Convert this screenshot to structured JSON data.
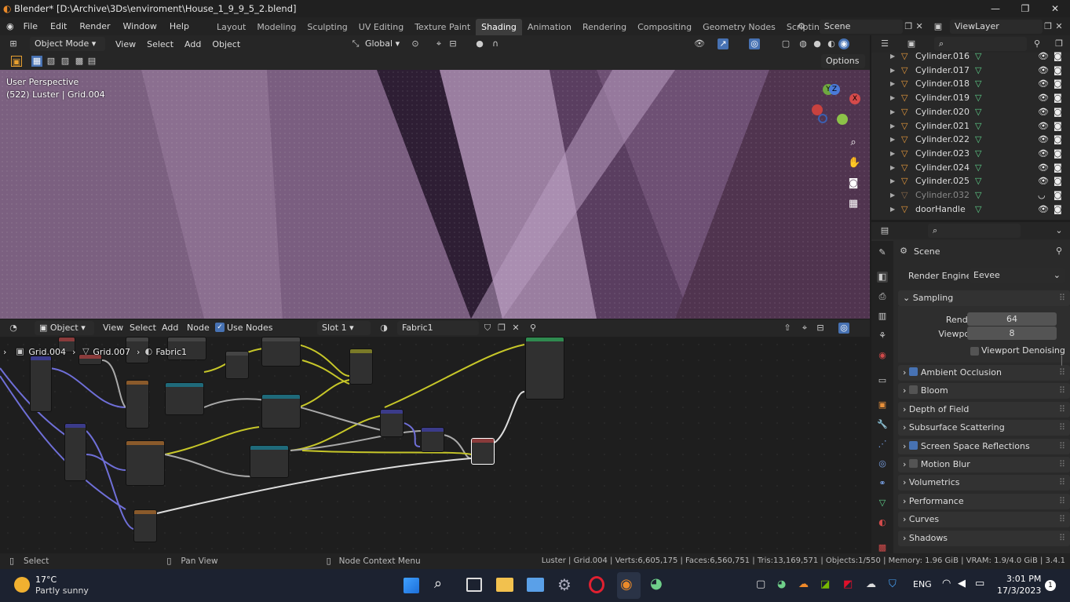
{
  "window": {
    "title": "Blender* [D:\\Archive\\3Ds\\enviroment\\House_1_9_9_5_2.blend]"
  },
  "menu": [
    "File",
    "Edit",
    "Render",
    "Window",
    "Help"
  ],
  "workspaces": [
    "Layout",
    "Modeling",
    "Sculpting",
    "UV Editing",
    "Texture Paint",
    "Shading",
    "Animation",
    "Rendering",
    "Compositing",
    "Geometry Nodes",
    "Scripting"
  ],
  "active_workspace": "Shading",
  "scene": {
    "name": "Scene",
    "view_layer": "ViewLayer"
  },
  "viewport": {
    "mode": "Object Mode",
    "menus": [
      "View",
      "Select",
      "Add",
      "Object"
    ],
    "transform": "Global",
    "options": "Options",
    "overlay_title": "User Perspective",
    "overlay_sub": "(522) Luster | Grid.004",
    "gizmo": {
      "x": "X",
      "y": "Y",
      "z": "Z"
    }
  },
  "node_editor": {
    "type": "Object",
    "menus": [
      "View",
      "Select",
      "Add",
      "Node"
    ],
    "use_nodes": "Use Nodes",
    "slot": "Slot 1",
    "material": "Fabric1",
    "breadcrumb": [
      "Grid.004",
      "Grid.007",
      "Fabric1"
    ]
  },
  "outliner": {
    "items": [
      "Cylinder.016",
      "Cylinder.017",
      "Cylinder.018",
      "Cylinder.019",
      "Cylinder.020",
      "Cylinder.021",
      "Cylinder.022",
      "Cylinder.023",
      "Cylinder.024",
      "Cylinder.025",
      "Cylinder.032",
      "doorHandle"
    ]
  },
  "properties": {
    "context": "Scene",
    "render_engine_label": "Render Engine",
    "render_engine": "Eevee",
    "sampling": {
      "label": "Sampling",
      "render_label": "Render",
      "render": "64",
      "viewport_label": "Viewport",
      "viewport": "8",
      "denoise": "Viewport Denoising"
    },
    "panels": [
      {
        "label": "Ambient Occlusion",
        "checkbox": true,
        "checked": true
      },
      {
        "label": "Bloom",
        "checkbox": true,
        "checked": false
      },
      {
        "label": "Depth of Field",
        "checkbox": false
      },
      {
        "label": "Subsurface Scattering",
        "checkbox": false
      },
      {
        "label": "Screen Space Reflections",
        "checkbox": true,
        "checked": true
      },
      {
        "label": "Motion Blur",
        "checkbox": true,
        "checked": false
      },
      {
        "label": "Volumetrics",
        "checkbox": false
      },
      {
        "label": "Performance",
        "checkbox": false
      },
      {
        "label": "Curves",
        "checkbox": false
      },
      {
        "label": "Shadows",
        "checkbox": false
      }
    ]
  },
  "statusbar": {
    "select": "Select",
    "pan": "Pan View",
    "context_menu": "Node Context Menu",
    "stats": "Luster | Grid.004 | Verts:6,605,175 | Faces:6,560,751 | Tris:13,169,571 | Objects:1/550 | Memory: 1.96 GiB | VRAM: 1.9/4.0 GiB | 3.4.1"
  },
  "taskbar": {
    "weather_temp": "17°C",
    "weather_desc": "Partly sunny",
    "lang": "ENG",
    "time": "3:01 PM",
    "date": "17/3/2023",
    "notif": "1"
  },
  "colors": {
    "accent": "#4772b3",
    "outliner_obj": "#e89a3c",
    "mesh_data": "#5fd08a",
    "fabric": "#7e5a84"
  }
}
